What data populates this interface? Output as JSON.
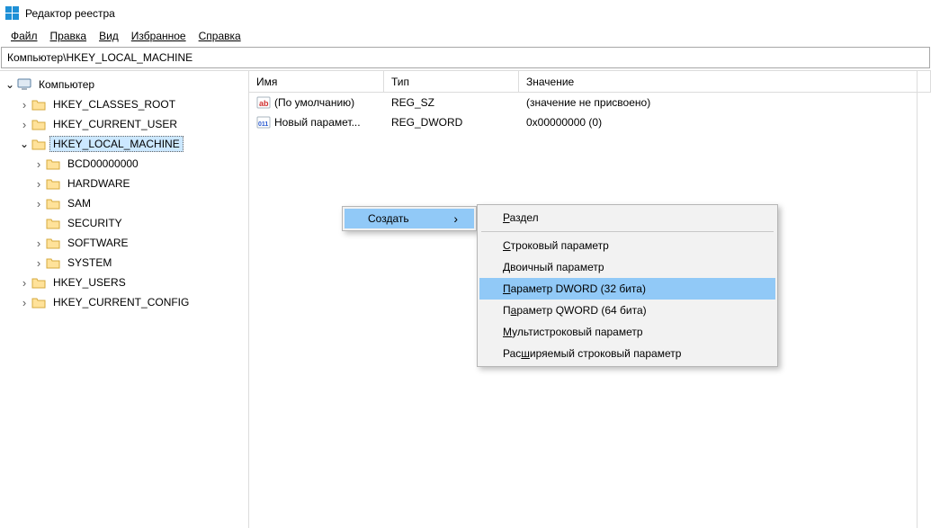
{
  "window": {
    "title": "Редактор реестра"
  },
  "menu": {
    "file": "Файл",
    "edit": "Правка",
    "view": "Вид",
    "favorites": "Избранное",
    "help": "Справка"
  },
  "address": "Компьютер\\HKEY_LOCAL_MACHINE",
  "tree": {
    "root": "Компьютер",
    "hkcr": "HKEY_CLASSES_ROOT",
    "hkcu": "HKEY_CURRENT_USER",
    "hklm": "HKEY_LOCAL_MACHINE",
    "hklm_children": {
      "bcd": "BCD00000000",
      "hardware": "HARDWARE",
      "sam": "SAM",
      "security": "SECURITY",
      "software": "SOFTWARE",
      "system": "SYSTEM"
    },
    "hku": "HKEY_USERS",
    "hkcc": "HKEY_CURRENT_CONFIG"
  },
  "list": {
    "headers": {
      "name": "Имя",
      "type": "Тип",
      "value": "Значение"
    },
    "rows": [
      {
        "name": "(По умолчанию)",
        "type": "REG_SZ",
        "value": "(значение не присвоено)",
        "icon": "ab"
      },
      {
        "name": "Новый парамет...",
        "type": "REG_DWORD",
        "value": "0x00000000 (0)",
        "icon": "bin"
      }
    ]
  },
  "context": {
    "parent": {
      "create": "Создать"
    },
    "submenu": {
      "key": "Раздел",
      "string": "Строковый параметр",
      "binary": "Двоичный параметр",
      "dword": "Параметр DWORD (32 бита)",
      "qword": "Параметр QWORD (64 бита)",
      "multistring": "Мультистроковый параметр",
      "expandstring": "Расширяемый строковый параметр"
    }
  }
}
